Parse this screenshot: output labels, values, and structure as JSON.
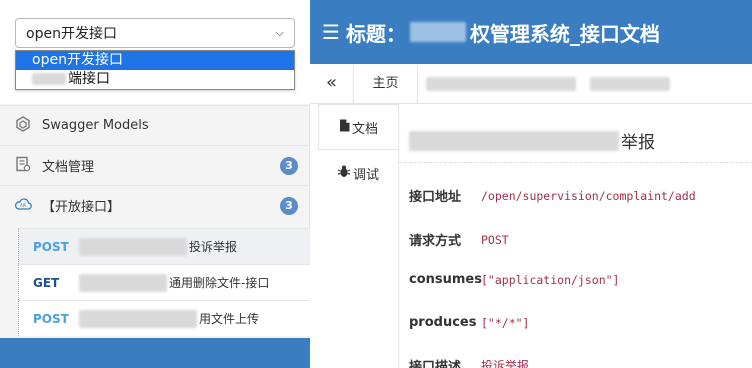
{
  "sidebar": {
    "group_select": {
      "value": "open开发接口"
    },
    "dropdown_options": [
      {
        "label": "open开发接口",
        "selected": true
      },
      {
        "label": "端接口",
        "selected": false
      }
    ],
    "nav_items": [
      {
        "label": "Swagger Models",
        "icon": "models-icon"
      },
      {
        "label": "文档管理",
        "icon": "doc-manage-icon",
        "badge": "3"
      },
      {
        "label": "【开放接口】",
        "icon": "cloud-api-icon",
        "badge": "3"
      }
    ],
    "api_items": [
      {
        "method": "POST",
        "title_suffix": "投诉举报",
        "active": true
      },
      {
        "method": "GET",
        "title_suffix": "通用删除文件-接口",
        "active": false
      },
      {
        "method": "POST",
        "title_suffix": "用文件上传",
        "active": false
      }
    ]
  },
  "header": {
    "menu_icon": "☰",
    "title_prefix": "标题：",
    "title_suffix": "权管理系统_接口文档"
  },
  "tabbar": {
    "collapse_glyph": "«",
    "home_label": "主页"
  },
  "vtabs": [
    {
      "label": "文档",
      "icon": "file-icon",
      "active": true
    },
    {
      "label": "调试",
      "icon": "bug-icon",
      "active": false
    }
  ],
  "doc": {
    "title_suffix": "举报",
    "rows": [
      {
        "label": "接口地址",
        "value": "/open/supervision/complaint/add"
      },
      {
        "label": "请求方式",
        "value": "POST"
      },
      {
        "label": "consumes",
        "value": "[\"application/json\"]"
      },
      {
        "label": "produces",
        "value": "[\"*/*\"]"
      },
      {
        "label": "接口描述",
        "value": "投诉举报"
      }
    ]
  },
  "colors": {
    "primary": "#3a7ec1",
    "badge": "#5b8ec9",
    "post_method": "#49a0e0",
    "get_method": "#1e4f8a",
    "code_value": "#a0314a",
    "dropdown_highlight": "#1e74e6"
  }
}
